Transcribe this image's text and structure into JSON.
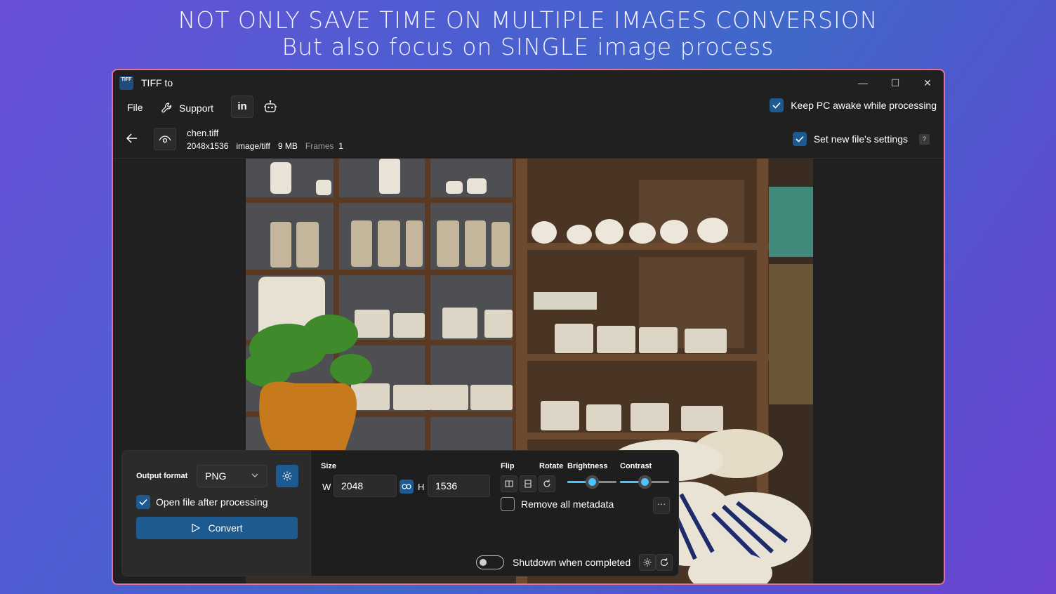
{
  "headline": {
    "line1": "NOT ONLY SAVE TIME ON MULTIPLE IMAGES CONVERSION",
    "line2": "But also focus on SINGLE image process"
  },
  "window": {
    "app_icon_text": "TIFF",
    "title": "TIFF to",
    "controls": {
      "minimize": "—",
      "maximize": "☐",
      "close": "✕"
    }
  },
  "menu": {
    "file": "File",
    "support": "Support",
    "linkedin": "in",
    "keep_awake": {
      "label": "Keep PC awake while processing",
      "checked": true
    }
  },
  "file_info": {
    "name": "chen.tiff",
    "dimensions": "2048x1536",
    "mime": "image/tiff",
    "size": "9 MB",
    "frames_label": "Frames",
    "frames_value": "1"
  },
  "new_settings": {
    "label": "Set new file's settings",
    "checked": true,
    "help": "?"
  },
  "output": {
    "format_label": "Output format",
    "format_value": "PNG",
    "open_after_label": "Open file after processing",
    "open_after_checked": true,
    "convert_label": "Convert"
  },
  "size": {
    "label": "Size",
    "w_label": "W",
    "w_value": "2048",
    "h_label": "H",
    "h_value": "1536"
  },
  "adjust": {
    "flip_label": "Flip",
    "rotate_label": "Rotate",
    "brightness_label": "Brightness",
    "brightness_level": 0.5,
    "contrast_label": "Contrast",
    "contrast_level": 0.5
  },
  "metadata": {
    "remove_label": "Remove all metadata",
    "checked": false,
    "more": "···"
  },
  "shutdown": {
    "label": "Shutdown when completed",
    "enabled": false
  },
  "colors": {
    "accent": "#1c5a8f",
    "slider": "#4cc2ff",
    "window_border": "#e0739a",
    "bg": "#202020"
  },
  "icons": [
    "back-arrow-icon",
    "eye-icon",
    "wrench-icon",
    "robot-icon",
    "gear-icon",
    "link-icon",
    "flip-horizontal-icon",
    "flip-vertical-icon",
    "rotate-icon",
    "refresh-icon",
    "play-icon",
    "chevron-down-icon"
  ]
}
